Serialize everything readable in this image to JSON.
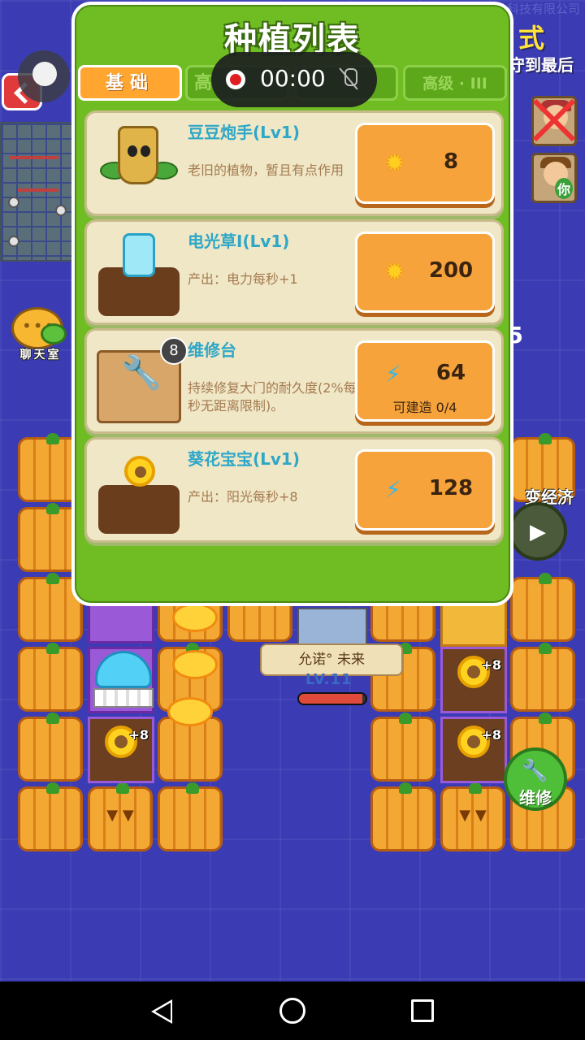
{
  "top": {
    "company": "成都水熊互动科技有限公司",
    "mode_title": "式",
    "mode_sub": "守到最后",
    "you_label": "你",
    "right_number": "5"
  },
  "sidebar": {
    "chat_label": "聊天室"
  },
  "right_side": {
    "economy_label": "变经济",
    "repair_label": "维修"
  },
  "recording": {
    "time": "00:00"
  },
  "panel": {
    "title": "种植列表",
    "tabs": [
      {
        "label": "基础",
        "active": true
      },
      {
        "label": "高",
        "active": false
      },
      {
        "label": "",
        "active": false
      },
      {
        "label": "高级 · III",
        "active": false
      }
    ],
    "items": [
      {
        "name": "豆豆炮手(Lv1)",
        "desc": "老旧的植物，暂且有点作用",
        "cost_icon": "sun-icon",
        "cost": "8",
        "sub": ""
      },
      {
        "name": "电光草Ⅰ(Lv1)",
        "desc": "产出：电力每秒+1",
        "cost_icon": "sun-icon",
        "cost": "200",
        "sub": ""
      },
      {
        "name": "维修台",
        "desc": "持续修复大门的耐久度(2%每秒无距离限制)。",
        "cost_icon": "bolt-icon",
        "cost": "64",
        "sub": "可建造 0/4",
        "badge": "8"
      },
      {
        "name": "葵花宝宝(Lv1)",
        "desc": "产出：阳光每秒+8",
        "cost_icon": "bolt-icon",
        "cost": "128",
        "sub": ""
      }
    ]
  },
  "field": {
    "sunflower_bonus": "+8",
    "player_name": "允诺° 未来",
    "player_level": "LV.11",
    "player_hp_fraction": 0.95
  },
  "colors": {
    "panel_green": "#6fbd22",
    "tab_orange": "#ffa530",
    "title_blue": "#2ea7c8",
    "board_blue": "#3b3cb4"
  }
}
